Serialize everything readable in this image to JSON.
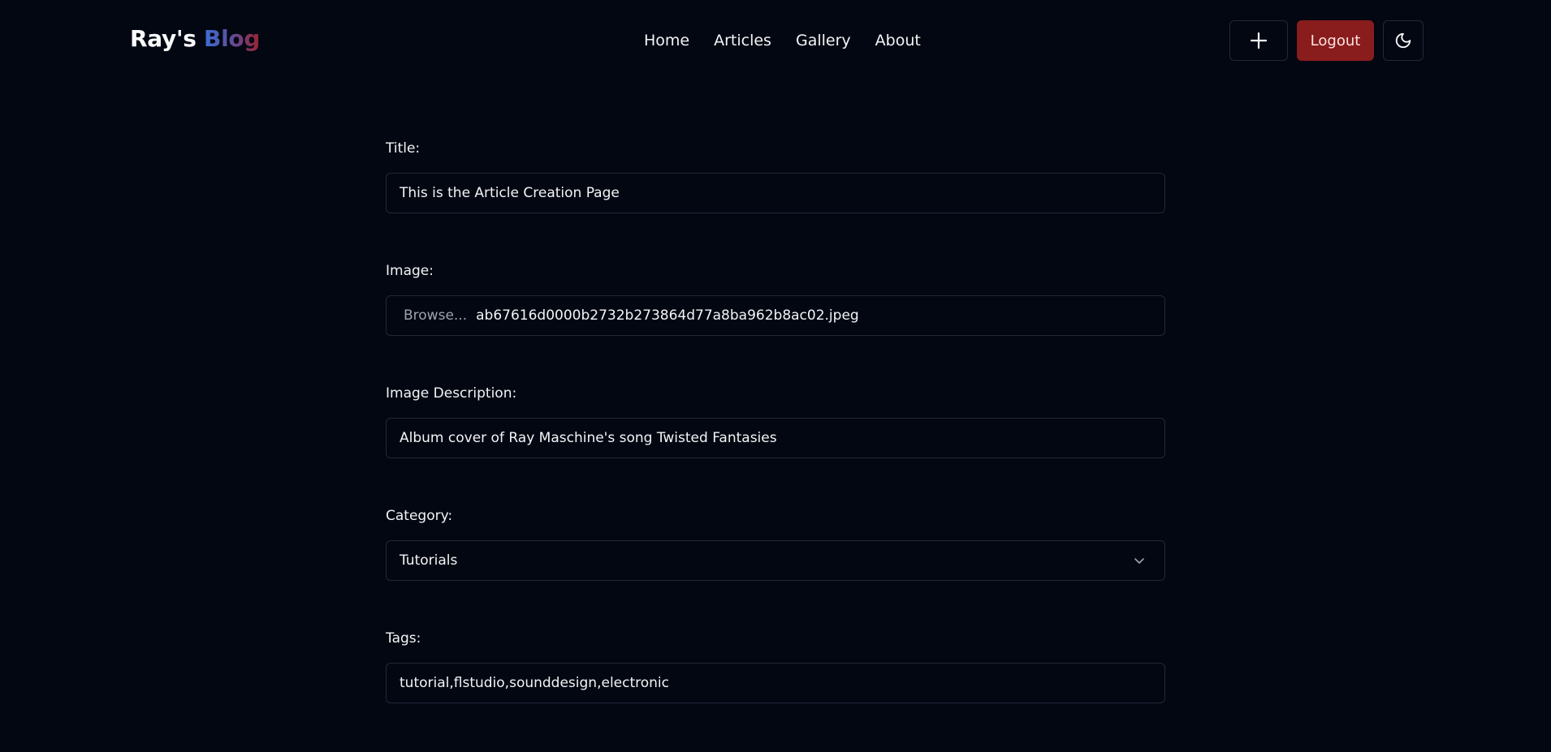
{
  "header": {
    "logo_main": "Ray's",
    "logo_accent": "Blog",
    "nav": [
      "Home",
      "Articles",
      "Gallery",
      "About"
    ],
    "add_icon": "plus-icon",
    "logout_label": "Logout",
    "theme_icon": "moon-icon",
    "colors": {
      "logout_bg": "#891c1c",
      "accent_gradient": [
        "#3b6fd8",
        "#9b2230"
      ]
    }
  },
  "form": {
    "title": {
      "label": "Title:",
      "value": "This is the Article Creation Page"
    },
    "image": {
      "label": "Image:",
      "browse_label": "Browse...",
      "filename": "ab67616d0000b2732b273864d77a8ba962b8ac02.jpeg"
    },
    "image_description": {
      "label": "Image Description:",
      "value": "Album cover of Ray Maschine's song Twisted Fantasies"
    },
    "category": {
      "label": "Category:",
      "selected": "Tutorials"
    },
    "tags": {
      "label": "Tags:",
      "value": "tutorial,flstudio,sounddesign,electronic"
    }
  }
}
